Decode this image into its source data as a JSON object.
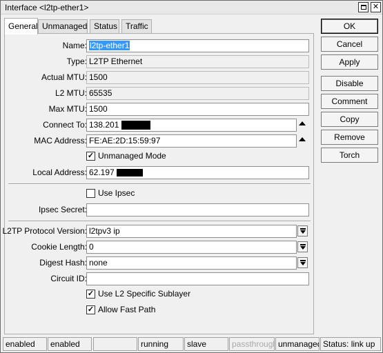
{
  "window": {
    "title": "Interface <l2tp-ether1>"
  },
  "tabs": [
    {
      "label": "General"
    },
    {
      "label": "Unmanaged"
    },
    {
      "label": "Status"
    },
    {
      "label": "Traffic"
    }
  ],
  "form": {
    "name_label": "Name:",
    "name_value": "l2tp-ether1",
    "type_label": "Type:",
    "type_value": "L2TP Ethernet",
    "actual_mtu_label": "Actual MTU:",
    "actual_mtu_value": "1500",
    "l2_mtu_label": "L2 MTU:",
    "l2_mtu_value": "65535",
    "max_mtu_label": "Max MTU:",
    "max_mtu_value": "1500",
    "connect_to_label": "Connect To:",
    "connect_to_value": "138.201",
    "mac_label": "MAC Address:",
    "mac_value": "FE:AE:2D:15:59:97",
    "unmanaged_mode_label": "Unmanaged Mode",
    "unmanaged_mode_checked": true,
    "local_address_label": "Local Address:",
    "local_address_value": "62.197",
    "use_ipsec_label": "Use Ipsec",
    "use_ipsec_checked": false,
    "ipsec_secret_label": "Ipsec Secret:",
    "ipsec_secret_value": "",
    "protocol_version_label": "L2TP Protocol Version:",
    "protocol_version_value": "l2tpv3 ip",
    "cookie_length_label": "Cookie Length:",
    "cookie_length_value": "0",
    "digest_hash_label": "Digest Hash:",
    "digest_hash_value": "none",
    "circuit_id_label": "Circuit ID:",
    "circuit_id_value": "",
    "l2_sublayer_label": "Use L2 Specific Sublayer",
    "l2_sublayer_checked": true,
    "fast_path_label": "Allow Fast Path",
    "fast_path_checked": true
  },
  "buttons": {
    "ok": "OK",
    "cancel": "Cancel",
    "apply": "Apply",
    "disable": "Disable",
    "comment": "Comment",
    "copy": "Copy",
    "remove": "Remove",
    "torch": "Torch"
  },
  "status": {
    "s1": "enabled",
    "s2": "enabled",
    "s3": "",
    "s4": "running",
    "s5": "slave",
    "s6": "passthrough",
    "s7": "unmanaged",
    "s8": "Status: link up"
  },
  "check_glyph": "✓"
}
